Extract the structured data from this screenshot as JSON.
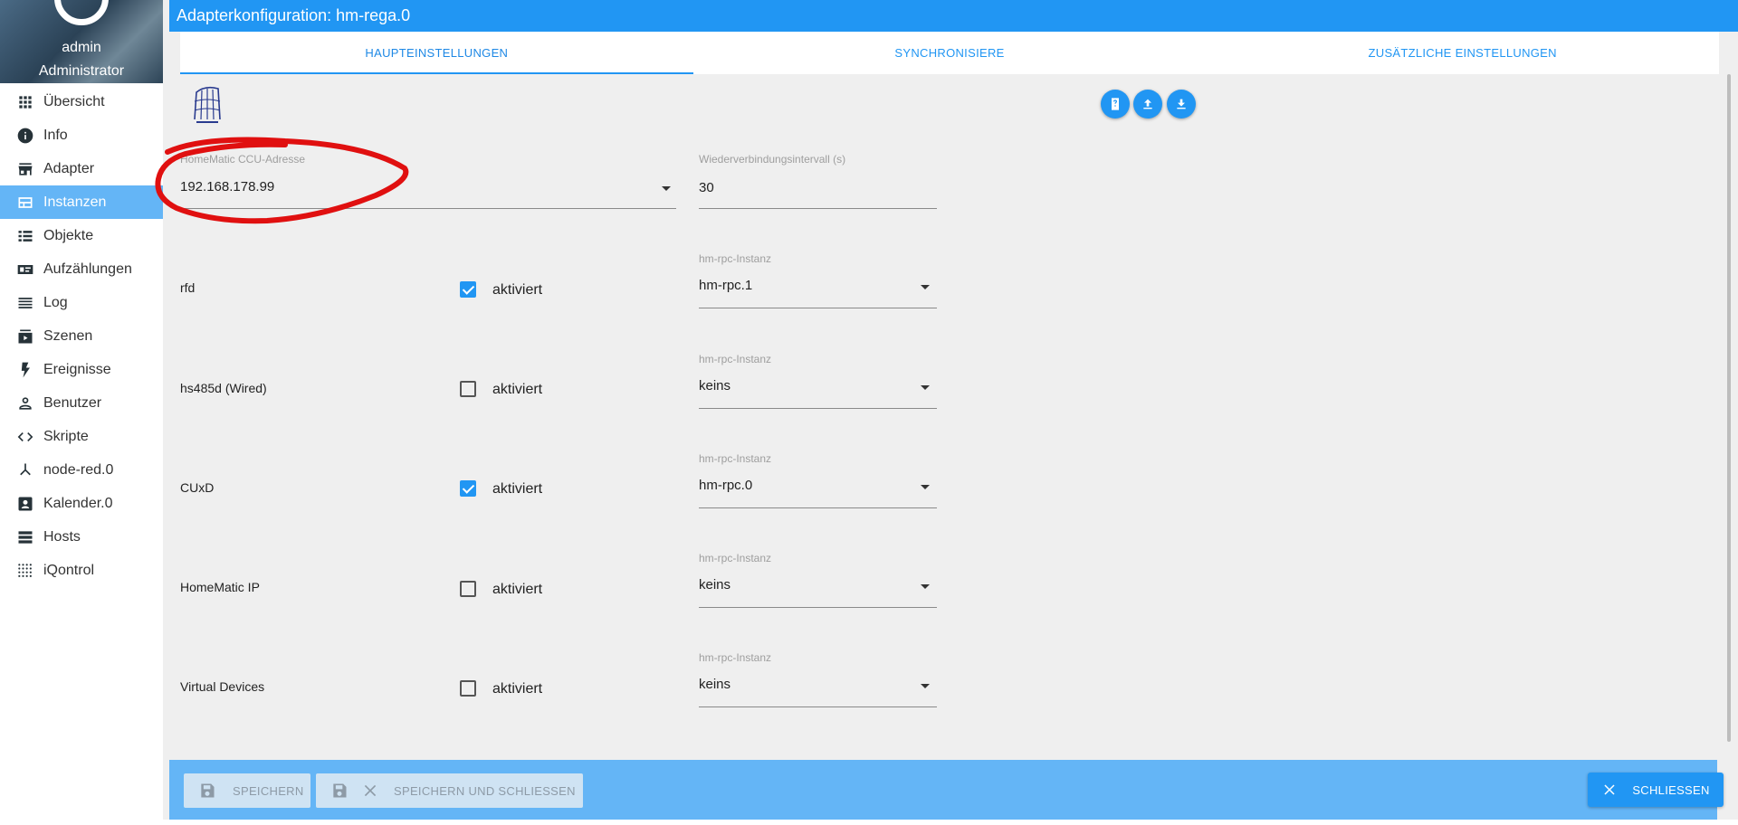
{
  "user": {
    "name": "admin",
    "role": "Administrator"
  },
  "nav": [
    {
      "label": "Übersicht",
      "icon": "grid-icon",
      "active": false
    },
    {
      "label": "Info",
      "icon": "info-icon",
      "active": false
    },
    {
      "label": "Adapter",
      "icon": "store-icon",
      "active": false
    },
    {
      "label": "Instanzen",
      "icon": "instances-icon",
      "active": true
    },
    {
      "label": "Objekte",
      "icon": "list-icon",
      "active": false
    },
    {
      "label": "Aufzählungen",
      "icon": "enum-icon",
      "active": false
    },
    {
      "label": "Log",
      "icon": "log-icon",
      "active": false
    },
    {
      "label": "Szenen",
      "icon": "scenes-icon",
      "active": false
    },
    {
      "label": "Ereignisse",
      "icon": "bolt-icon",
      "active": false
    },
    {
      "label": "Benutzer",
      "icon": "user-icon",
      "active": false
    },
    {
      "label": "Skripte",
      "icon": "code-icon",
      "active": false
    },
    {
      "label": "node-red.0",
      "icon": "node-red-icon",
      "active": false
    },
    {
      "label": "Kalender.0",
      "icon": "calendar-icon",
      "active": false
    },
    {
      "label": "Hosts",
      "icon": "hosts-icon",
      "active": false
    },
    {
      "label": "iQontrol",
      "icon": "dots-grid-icon",
      "active": false
    }
  ],
  "title": "Adapterkonfiguration: hm-rega.0",
  "tabs": [
    "HAUPTEINSTELLUNGEN",
    "SYNCHRONISIERE",
    "ZUSÄTZLICHE EINSTELLUNGEN"
  ],
  "active_tab": 0,
  "ccu": {
    "label": "HomeMatic CCU-Adresse",
    "value": "192.168.178.99"
  },
  "reconnect": {
    "label": "Wiederverbindungsintervall (s)",
    "value": "30"
  },
  "instance_label": "hm-rpc-Instanz",
  "rows": [
    {
      "label": "rfd",
      "checked": true,
      "check_label": "aktiviert",
      "instance": "hm-rpc.1"
    },
    {
      "label": "hs485d (Wired)",
      "checked": false,
      "check_label": "aktiviert",
      "instance": "keins"
    },
    {
      "label": "CUxD",
      "checked": true,
      "check_label": "aktiviert",
      "instance": "hm-rpc.0"
    },
    {
      "label": "HomeMatic IP",
      "checked": false,
      "check_label": "aktiviert",
      "instance": "keins"
    },
    {
      "label": "Virtual Devices",
      "checked": false,
      "check_label": "aktiviert",
      "instance": "keins"
    }
  ],
  "buttons": {
    "save": "SPEICHERN",
    "save_close": "SPEICHERN UND SCHLIESSEN",
    "close": "SCHLIESSEN"
  },
  "colors": {
    "primary": "#2196f3",
    "sidebar_active": "#64b5f6",
    "annotation": "#e01010"
  }
}
